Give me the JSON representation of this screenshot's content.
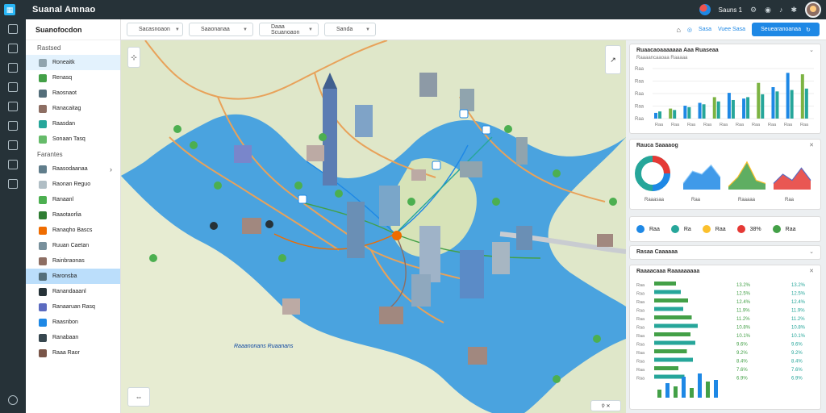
{
  "app": {
    "title": "Suanal Amnao",
    "logo": "logo-mark"
  },
  "topbar": {
    "user_text": "Sauns 1",
    "icons": [
      "settings-icon",
      "user-icon",
      "bell-icon",
      "gear-icon"
    ]
  },
  "rail": {
    "icons": [
      "dashboard-icon",
      "layers-icon",
      "map-icon",
      "chart-icon",
      "calendar-icon",
      "folder-icon",
      "doc-icon",
      "archive-icon",
      "cloud-icon",
      "help-icon"
    ]
  },
  "sidebar": {
    "title": "Suanofocdon",
    "sections": [
      {
        "title": "Rastsed",
        "items": [
          {
            "label": "Roneaitk",
            "color": "#90a4ae",
            "state": "active"
          },
          {
            "label": "Renasq",
            "color": "#43a047"
          },
          {
            "label": "Raosnaot",
            "color": "#546e7a"
          },
          {
            "label": "Ranacaitag",
            "color": "#8d6e63"
          },
          {
            "label": "Raasdan",
            "color": "#26a69a"
          },
          {
            "label": "Sonaan Tasq",
            "color": "#66bb6a"
          }
        ]
      },
      {
        "title": "Farantes",
        "items": [
          {
            "label": "Raasodaanaa",
            "color": "#607d8b",
            "chevron": true
          },
          {
            "label": "Raonan Reguo",
            "color": "#b0bec5"
          },
          {
            "label": "Ranaanl",
            "color": "#4caf50"
          },
          {
            "label": "Raaotaorlia",
            "color": "#2e7d32"
          },
          {
            "label": "Ranaqho Bascs",
            "color": "#ef6c00"
          },
          {
            "label": "Ruuan Caetan",
            "color": "#78909c"
          },
          {
            "label": "Rainbraonas",
            "color": "#8d6e63"
          },
          {
            "label": "Raronsba",
            "color": "#546e7a",
            "state": "selected"
          },
          {
            "label": "Ranandaaanl",
            "color": "#263238"
          },
          {
            "label": "Ranaaruan Rasq",
            "color": "#5c6bc0"
          },
          {
            "label": "Raasnbon",
            "color": "#1e88e5"
          },
          {
            "label": "Ranabaan",
            "color": "#37474f"
          },
          {
            "label": "Raaa Raor",
            "color": "#795548"
          }
        ]
      }
    ]
  },
  "filters": {
    "dropdowns": [
      "Sacasnoaon",
      "Saaonanaa",
      "Daaa Scuanoaon",
      "Sanda"
    ],
    "actions": [
      "Sasa",
      "Vuee Sasa"
    ],
    "cta": "Seuearanoanaa"
  },
  "map": {
    "label": "Raaanonans Ruaanans"
  },
  "panels": {
    "bar_card": {
      "title": "Ruaacaoaaaaaaa Aaa Ruaseaa",
      "subtitle": "Raaaancaaoaa Raaaaa"
    },
    "mini_card": {
      "title": "Rauca Saaaaog",
      "captions": [
        "Raaasaa",
        "Raa",
        "Raaaaa",
        "Raa"
      ]
    },
    "legend": {
      "items": [
        {
          "color": "#1e88e5",
          "text": "Raa"
        },
        {
          "color": "#26a69a",
          "text": "Ra"
        },
        {
          "color": "#fbc02d",
          "text": "Raa"
        },
        {
          "color": "#e53935",
          "text": "38%"
        },
        {
          "color": "#43a047",
          "text": "Raa"
        }
      ]
    },
    "table_card": {
      "title": "Rasaa Caaaaaa"
    },
    "ranking_card": {
      "title": "Raaaacaaa Raaaaaaaaa"
    }
  },
  "chart_data": [
    {
      "type": "bar",
      "title": "Ruaacaoaaaaaaa Aaa Ruaseaa",
      "categories": [
        "Raa",
        "Raa",
        "Raa",
        "Raa",
        "Raa",
        "Raa",
        "Raa",
        "Raa",
        "Raa",
        "Raa"
      ],
      "ytick_labels": [
        "Raa",
        "Raa",
        "Raa",
        "Raa",
        "Raa"
      ],
      "series": [
        {
          "values": [
            8,
            14,
            18,
            22,
            30,
            36,
            28,
            50,
            44,
            64,
            62
          ]
        },
        {
          "values": [
            10,
            12,
            16,
            20,
            24,
            26,
            30,
            34,
            38,
            40,
            42
          ]
        }
      ],
      "ylim": [
        0,
        70
      ]
    },
    {
      "type": "area",
      "title": "Rauca Saaaaog",
      "series": [
        {
          "values": [
            2,
            6,
            5,
            8,
            4
          ]
        },
        {
          "values": [
            1,
            4,
            9,
            3,
            2
          ]
        },
        {
          "values": [
            2,
            5,
            3,
            7,
            3
          ]
        }
      ]
    },
    {
      "type": "bar",
      "title": "Raaaacaaa Raaaaaaaaa",
      "orientation": "horizontal",
      "categories": [
        "Raa",
        "Raa",
        "Raa",
        "Raa",
        "Raa",
        "Raa",
        "Raa",
        "Raa",
        "Raa",
        "Raa",
        "Raa",
        "Raa"
      ],
      "values": [
        18,
        22,
        28,
        24,
        31,
        36,
        30,
        34,
        27,
        32,
        20,
        25
      ],
      "labels": [
        "13.2%",
        "12.5%",
        "12.4%",
        "11.9%",
        "11.2%",
        "10.8%",
        "10.1%",
        "9.6%",
        "9.2%",
        "8.4%",
        "7.6%",
        "6.9%"
      ]
    }
  ]
}
